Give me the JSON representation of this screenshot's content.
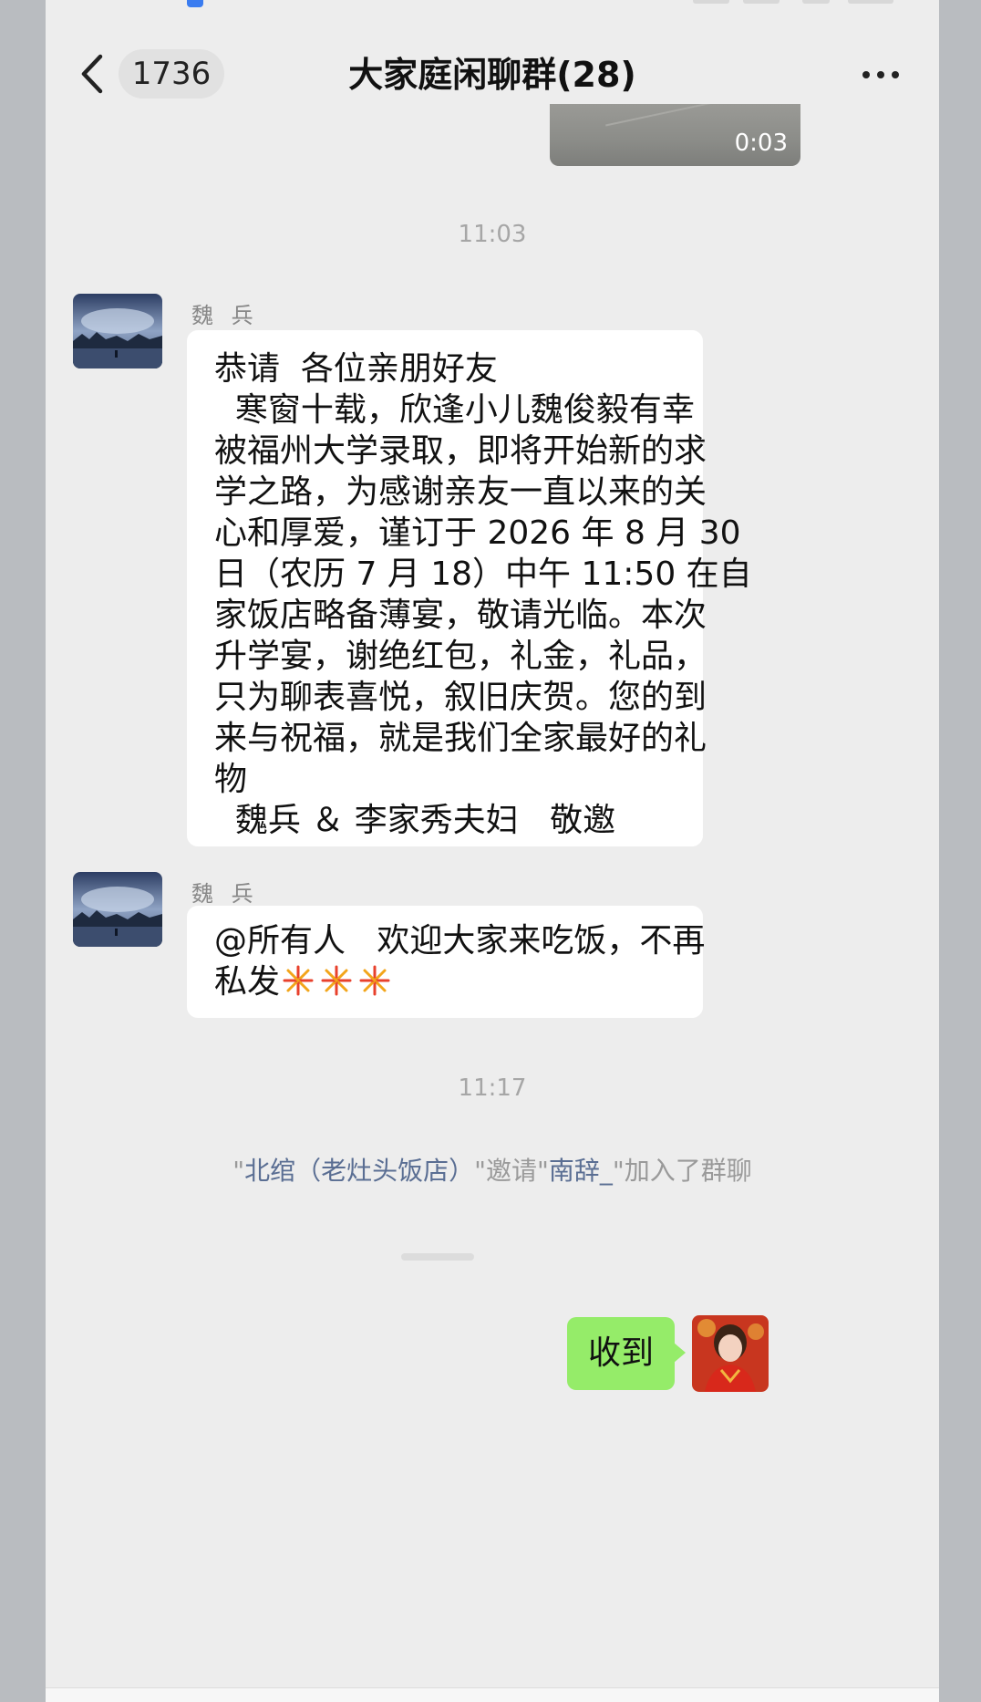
{
  "navbar": {
    "unread_count": "1736",
    "title": "大家庭闲聊群(28)",
    "more_icon": "ellipsis-icon",
    "back_icon": "chevron-left-icon"
  },
  "video_message": {
    "duration": "0:03"
  },
  "timestamps": {
    "first": "11:03",
    "second": "11:17"
  },
  "messages": [
    {
      "sender": "魏 兵",
      "lines": [
        "恭请  各位亲朋好友",
        "  寒窗十载，欣逢小儿魏俊毅有幸",
        "被福州大学录取，即将开始新的求",
        "学之路，为感谢亲友一直以来的关",
        "心和厚爱，谨订于 2026 年 8 月 30",
        "日（农历 7 月 18）中午 11:50 在自",
        "家饭店略备薄宴，敬请光临。本次",
        "升学宴，谢绝红包，礼金，礼品，",
        "只为聊表喜悦，叙旧庆贺。您的到",
        "来与祝福，就是我们全家最好的礼",
        "物",
        "  魏兵 ＆ 李家秀夫妇   敬邀"
      ]
    },
    {
      "sender": "魏 兵",
      "line1": "@所有人   欢迎大家来吃饭，不再",
      "line2": "私发"
    }
  ],
  "system_message": {
    "quote_open": "\"",
    "inviter": "北绾（老灶头饭店）",
    "middle": "\"邀请\"",
    "invitee": "南辞_",
    "tail": "\"加入了群聊"
  },
  "my_message": {
    "text": "收到"
  },
  "colors": {
    "chat_bg": "#ededed",
    "my_bubble": "#95ec69",
    "link": "#5a6e93"
  }
}
